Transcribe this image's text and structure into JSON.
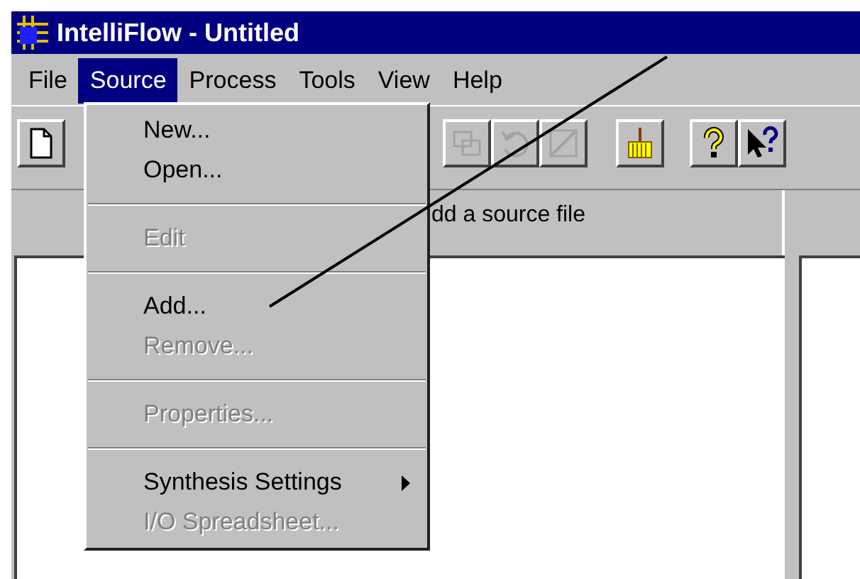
{
  "window": {
    "title": "IntelliFlow - Untitled"
  },
  "menubar": [
    {
      "label": "File",
      "selected": false
    },
    {
      "label": "Source",
      "selected": true
    },
    {
      "label": "Process",
      "selected": false
    },
    {
      "label": "Tools",
      "selected": false
    },
    {
      "label": "View",
      "selected": false
    },
    {
      "label": "Help",
      "selected": false
    }
  ],
  "toolbar": [
    {
      "kind": "document",
      "disabled": false
    },
    {
      "kind": "copy",
      "disabled": true
    },
    {
      "kind": "undo",
      "disabled": true
    },
    {
      "kind": "clear",
      "disabled": true
    },
    {
      "kind": "broom",
      "disabled": false
    },
    {
      "kind": "help",
      "disabled": false
    },
    {
      "kind": "context-help",
      "disabled": false
    }
  ],
  "hint": "dd a source file",
  "menu": [
    {
      "kind": "item",
      "label": "New...",
      "disabled": false
    },
    {
      "kind": "item",
      "label": "Open...",
      "disabled": false
    },
    {
      "kind": "separator"
    },
    {
      "kind": "item",
      "label": "Edit",
      "disabled": true
    },
    {
      "kind": "separator"
    },
    {
      "kind": "item",
      "label": "Add...",
      "disabled": false
    },
    {
      "kind": "item",
      "label": "Remove...",
      "disabled": true
    },
    {
      "kind": "separator"
    },
    {
      "kind": "item",
      "label": "Properties...",
      "disabled": true
    },
    {
      "kind": "separator"
    },
    {
      "kind": "submenu",
      "label": "Synthesis Settings",
      "disabled": false
    },
    {
      "kind": "item",
      "label": "I/O Spreadsheet...",
      "disabled": true
    }
  ]
}
